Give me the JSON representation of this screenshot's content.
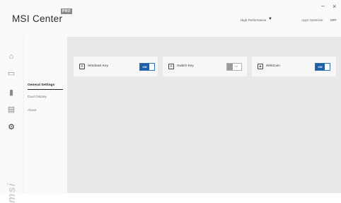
{
  "header": {
    "logo_text": "MSI Center",
    "pro_badge": "PRO",
    "performance_label": "High Performance",
    "performance_arrow": "▼",
    "apps_optimizer_label": "Apps Optimizer",
    "apps_optimizer_value": "OFF",
    "minimize_glyph": "–",
    "close_glyph": "×"
  },
  "rail": {
    "items": [
      {
        "icon": "home-icon",
        "glyph": "⌂"
      },
      {
        "icon": "monitor-icon",
        "glyph": "▭"
      },
      {
        "icon": "chart-icon",
        "glyph": "▮"
      },
      {
        "icon": "toolbox-icon",
        "glyph": "▤"
      },
      {
        "icon": "settings-icon",
        "glyph": "⚙"
      }
    ],
    "watermark": "msi"
  },
  "subnav": {
    "items": [
      "General Settings",
      "Dual Display",
      "About"
    ],
    "active_index": 0
  },
  "cards": [
    {
      "label": "Windows Key",
      "toggle_label": "ON",
      "state": "on",
      "icon": "windows-key-icon",
      "glyph": "⊞"
    },
    {
      "label": "Switch Key",
      "toggle_label": "ON",
      "state": "disabled",
      "icon": "switch-key-icon",
      "glyph": "⊞"
    },
    {
      "label": "WebCam",
      "toggle_label": "ON",
      "state": "on",
      "icon": "webcam-icon",
      "glyph": "◉"
    }
  ],
  "colors": {
    "accent": "#1f5fa8",
    "background": "#e9e9e9",
    "panel": "#fafafa",
    "card": "#f7f7f7"
  }
}
